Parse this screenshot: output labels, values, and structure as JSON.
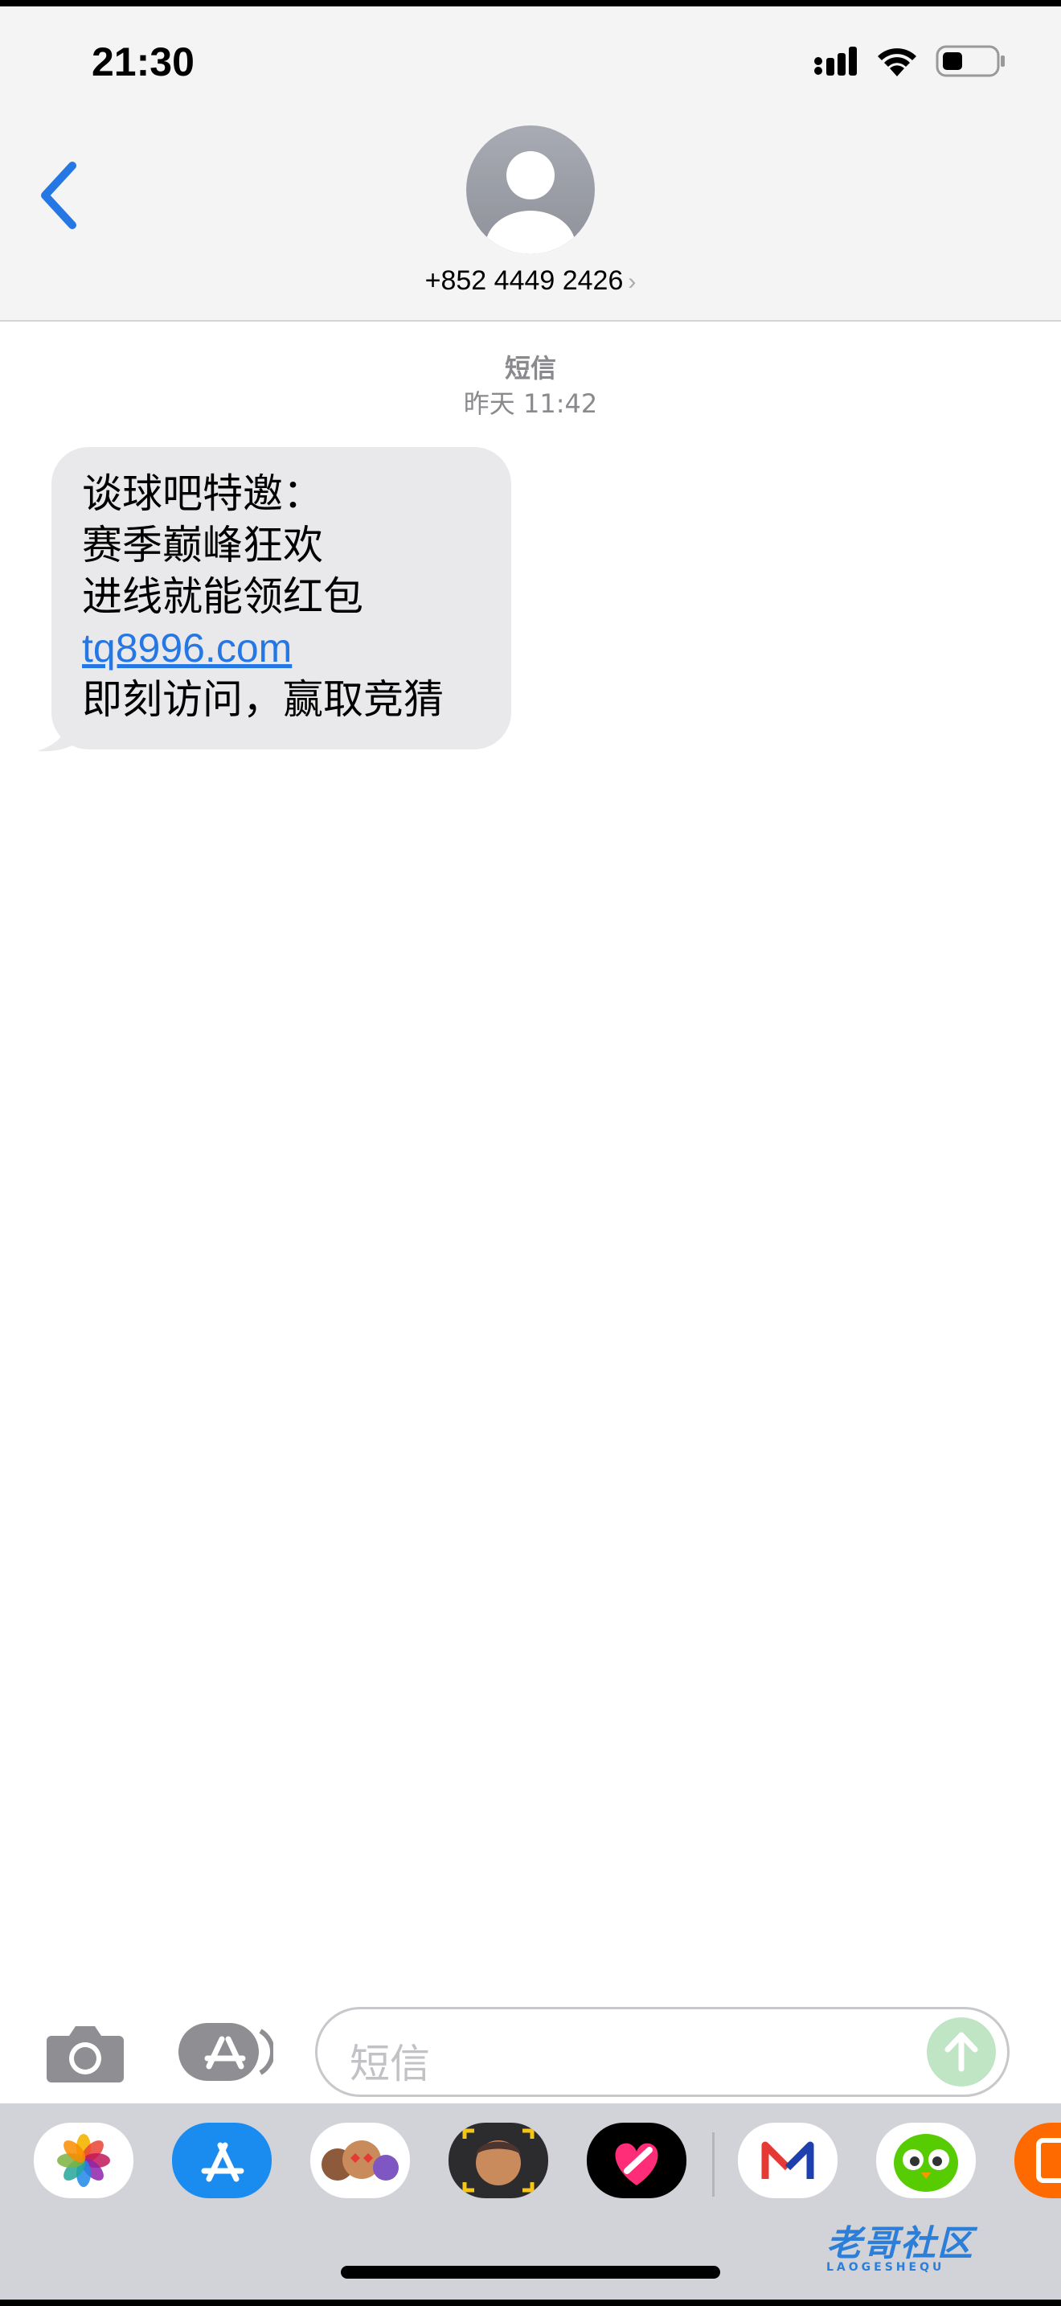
{
  "status_bar": {
    "time": "21:30"
  },
  "header": {
    "contact": "+852 4449 2426",
    "chevron": "›"
  },
  "thread": {
    "service": "短信",
    "timestamp": "昨天 11:42",
    "message": {
      "line1": "谈球吧特邀：",
      "line2": "赛季巅峰狂欢",
      "line3": "进线就能领红包",
      "link": "tq8996.com",
      "line5": "即刻访问，赢取竞猜"
    }
  },
  "composer": {
    "placeholder": "短信"
  },
  "app_drawer": {
    "apps": [
      "photos-icon",
      "app-store-icon",
      "memoji-stickers-icon",
      "memoji-icon",
      "digital-touch-icon",
      "mail-app-icon",
      "duolingo-icon",
      "clipboard-app-icon"
    ]
  },
  "watermark": {
    "text": "老哥社区",
    "subtext": "LAOGESHEQU"
  },
  "colors": {
    "accent": "#2577e3",
    "bubble": "#e9e9eb",
    "header": "#f4f4f5",
    "send": "#bfe5c5"
  }
}
